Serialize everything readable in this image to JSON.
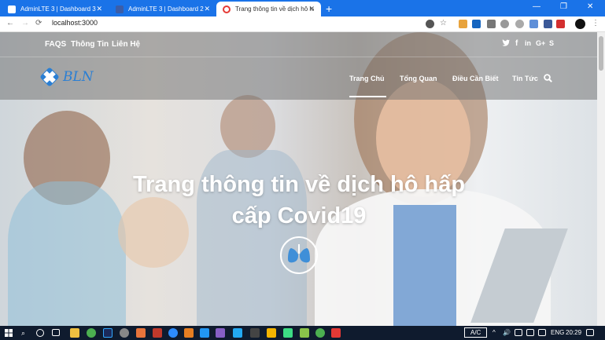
{
  "browser": {
    "tabs": [
      {
        "title": "AdminLTE 3 | Dashboard 3",
        "close": "✕"
      },
      {
        "title": "AdminLTE 3 | Dashboard 2",
        "close": "✕"
      },
      {
        "title": "Trang thông tin về dịch hô hấp c",
        "close": "✕"
      }
    ],
    "new_tab": "+",
    "url": "localhost:3000",
    "window_controls": {
      "minimize": "—",
      "restore": "❐",
      "close": "✕"
    },
    "nav": {
      "back": "←",
      "forward": "→",
      "reload": "⟳"
    }
  },
  "site": {
    "topbar": {
      "links": [
        "FAQS",
        "Thông Tin",
        "Liên Hệ"
      ],
      "social": {
        "twitter": "🐦",
        "facebook": "f",
        "linkedin": "in",
        "google": "G+",
        "skype": "S"
      }
    },
    "logo_text": "BLN",
    "nav": {
      "items": [
        "Trang Chủ",
        "Tổng Quan",
        "Điều Cần Biết",
        "Tin Tức"
      ],
      "active": "Trang Chủ",
      "search_icon": "search-icon"
    },
    "hero": {
      "title_line1": "Trang thông tin về dịch hô hấp",
      "title_line2": "cấp Covid19",
      "emblem": "lungs-icon"
    }
  },
  "taskbar": {
    "ac": "A/C",
    "lang": "ENG",
    "time": "20:29"
  },
  "colors": {
    "chrome_blue": "#1a73e8",
    "logo_blue": "#2a7fd4",
    "taskbar": "#0f1b2e"
  }
}
